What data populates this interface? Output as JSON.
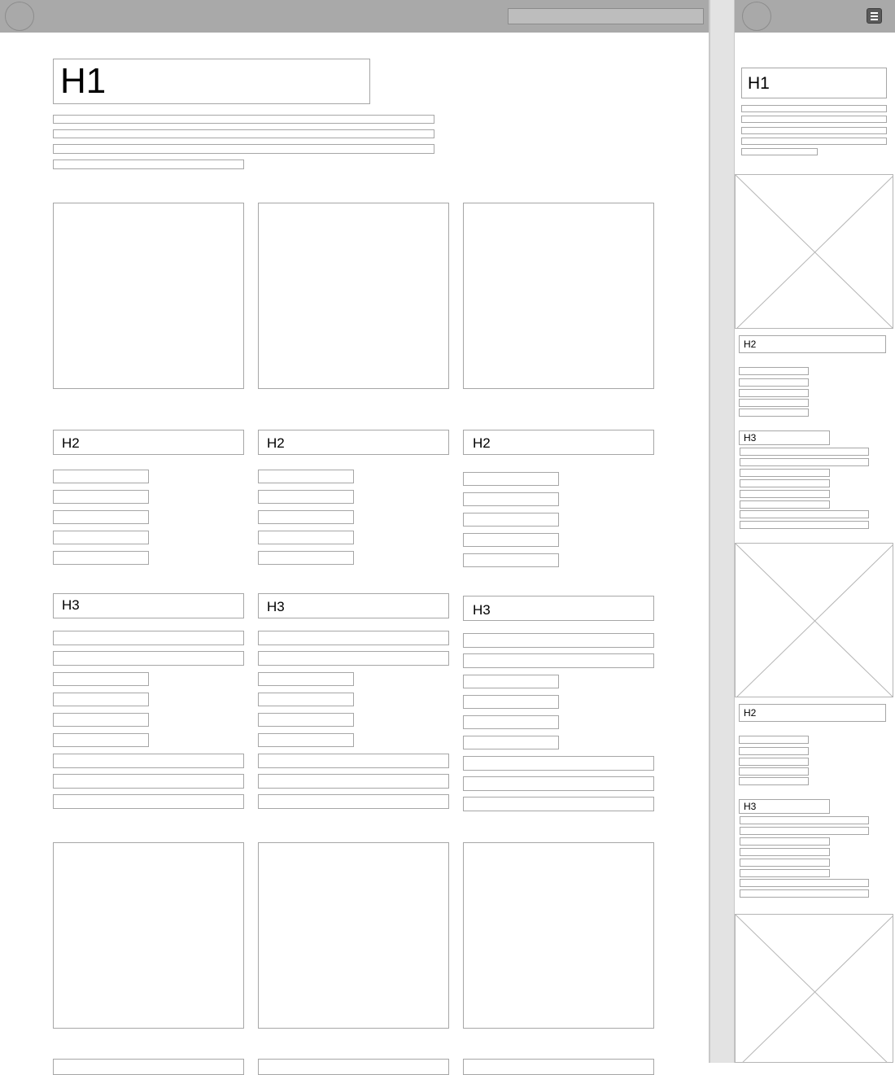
{
  "desktop": {
    "heading_h1": "H1",
    "columns": [
      {
        "h2": "H2",
        "h3": "H3"
      },
      {
        "h2": "H2",
        "h3": "H3"
      },
      {
        "h2": "H2",
        "h3": "H3"
      }
    ]
  },
  "mobile": {
    "heading_h1": "H1",
    "sections": [
      {
        "h2": "H2",
        "h3": "H3"
      },
      {
        "h2": "H2",
        "h3": "H3"
      }
    ]
  },
  "icons": {
    "logo": "logo-circle-icon",
    "menu": "hamburger-menu-icon",
    "image_placeholder": "image-placeholder-icon"
  },
  "colors": {
    "header_bar": "#a9a9a9",
    "placeholder_border": "#a6a6a6",
    "gutter": "#e3e3e3",
    "menu_button": "#5a5a5a"
  }
}
